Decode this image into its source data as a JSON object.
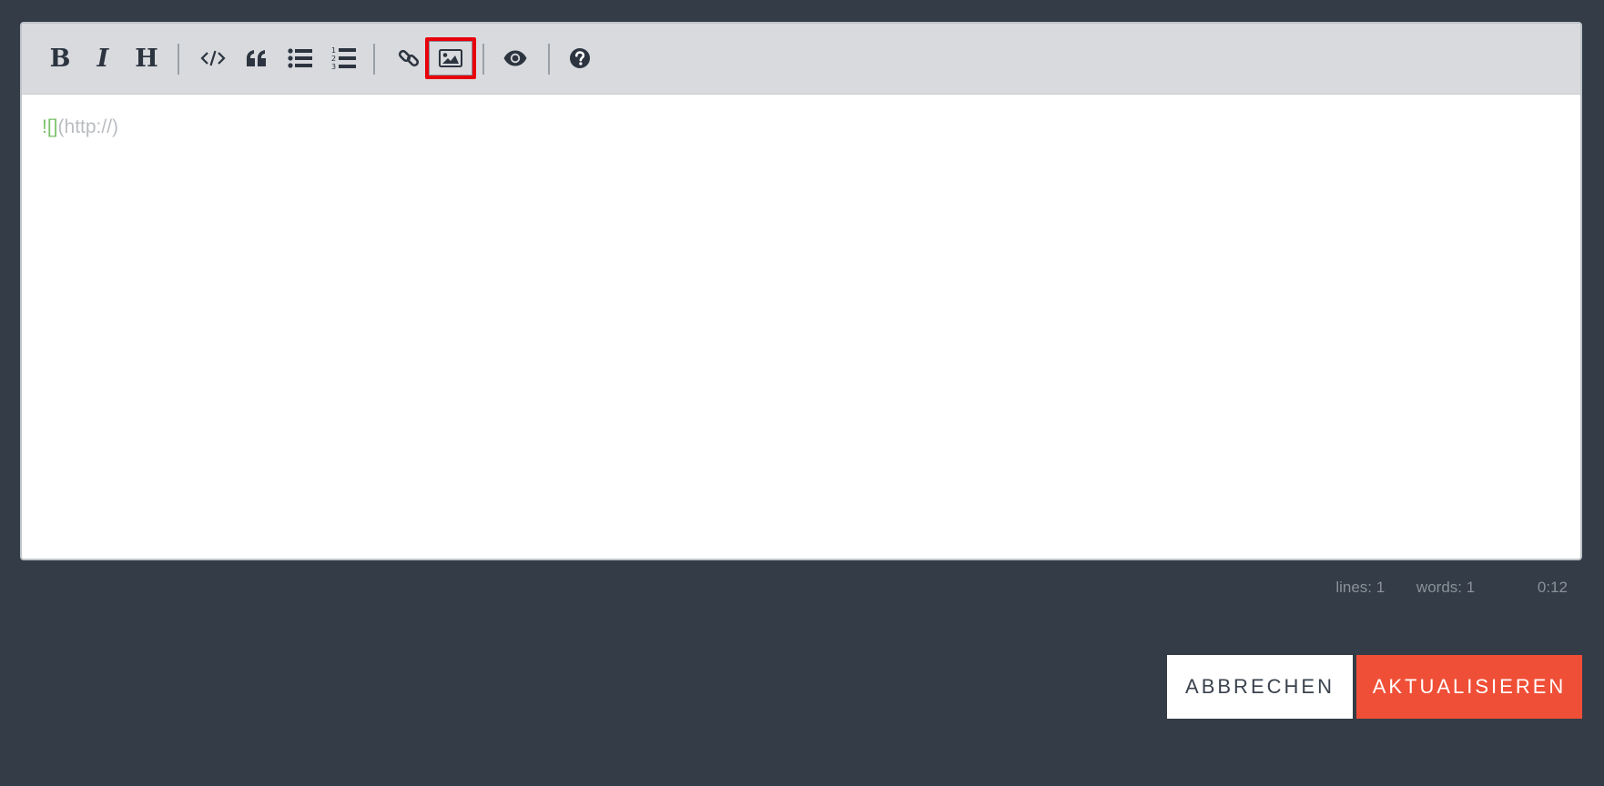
{
  "toolbar": {
    "bold_label": "B",
    "italic_label": "I",
    "heading_label": "H",
    "icons": [
      "bold-icon",
      "italic-icon",
      "heading-icon",
      "code-icon",
      "quote-icon",
      "unordered-list-icon",
      "ordered-list-icon",
      "link-icon",
      "image-icon",
      "preview-eye-icon",
      "help-icon"
    ],
    "active_tool": "image"
  },
  "editor": {
    "content_bang": "!",
    "content_brackets": "[]",
    "content_url": "(http://)"
  },
  "status": {
    "lines": "lines: 1",
    "words": "words: 1",
    "cursor": "0:12"
  },
  "actions": {
    "cancel_label": "ABBRECHEN",
    "update_label": "AKTUALISIEREN"
  },
  "colors": {
    "background": "#333c47",
    "toolbar": "#d8dadd",
    "accent": "#f04f37",
    "highlight": "#e8000b",
    "markdown_green": "#7cc36a"
  }
}
